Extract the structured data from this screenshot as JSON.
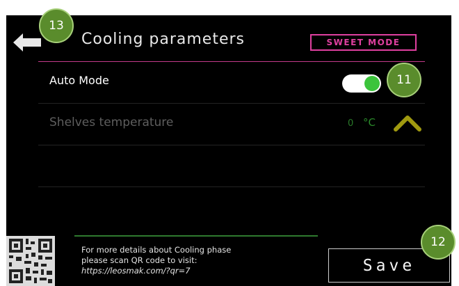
{
  "header": {
    "title": "Cooling parameters",
    "mode_badge": "SWEET MODE",
    "back_icon": "arrow-left-icon"
  },
  "rows": [
    {
      "label": "Auto Mode",
      "control": "toggle",
      "toggle_on": true
    },
    {
      "label": "Shelves temperature",
      "value": "0",
      "unit": "°C",
      "control": "chevron-up",
      "disabled": true
    }
  ],
  "footer": {
    "info_line1": "For more details about Cooling phase",
    "info_line2": "please scan QR code to visit:",
    "info_url": "https://leosmak.com/?qr=7",
    "save_label": "Save"
  },
  "callouts": {
    "back": "13",
    "toggle": "11",
    "save": "12"
  },
  "colors": {
    "accent_magenta": "#e040a0",
    "toggle_green": "#3cc43c",
    "chevron_olive": "#a09a10",
    "callout_green": "#5a8c2c"
  }
}
